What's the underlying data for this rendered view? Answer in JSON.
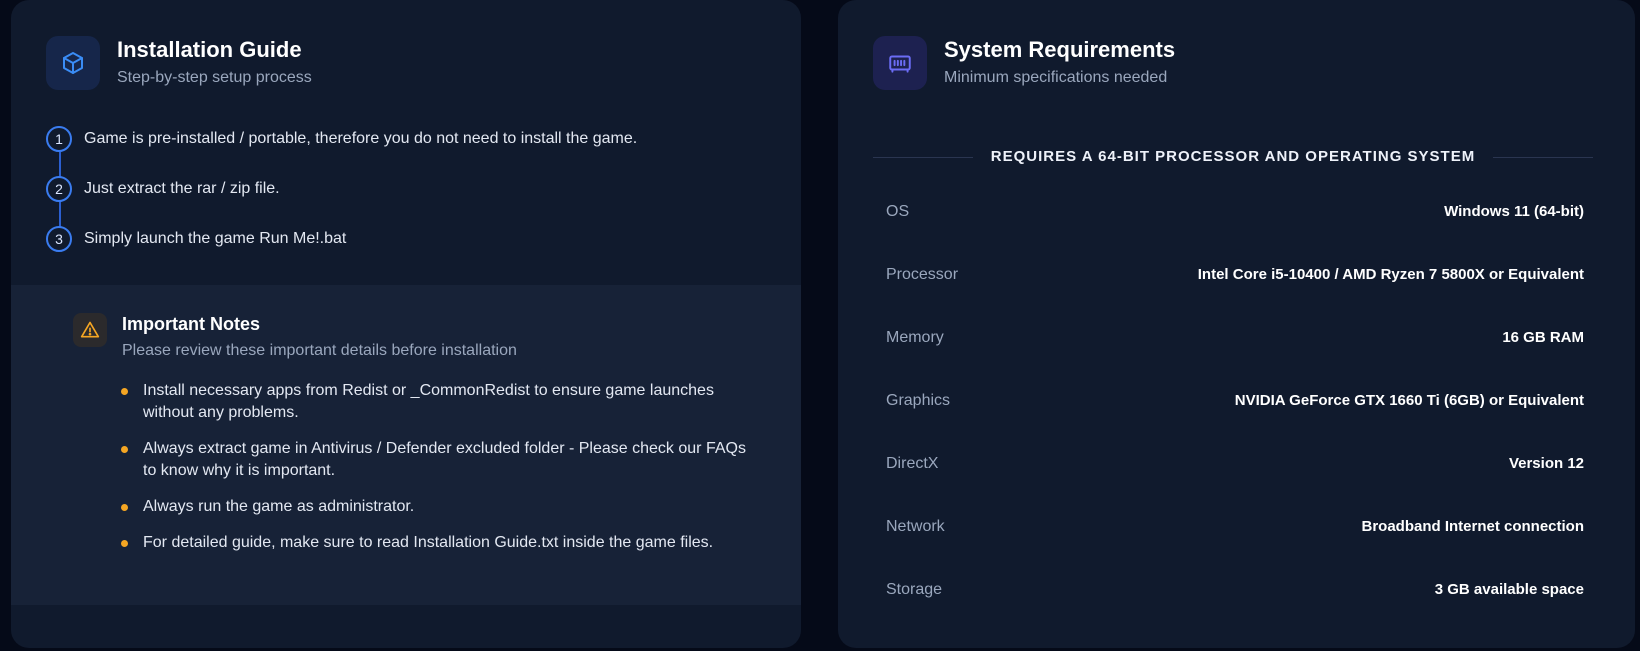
{
  "installation": {
    "title": "Installation Guide",
    "subtitle": "Step-by-step setup process",
    "steps": [
      {
        "num": "1",
        "text": "Game is pre-installed / portable, therefore you do not need to install the game."
      },
      {
        "num": "2",
        "text": "Just extract the rar / zip file."
      },
      {
        "num": "3",
        "text": "Simply launch the game Run Me!.bat"
      }
    ],
    "icon": "cube-icon",
    "accent": "#3a7cf0"
  },
  "notes": {
    "title": "Important Notes",
    "subtitle": "Please review these important details before installation",
    "icon": "warning-icon",
    "bullet_color": "#f5a623",
    "items": [
      "Install necessary apps from Redist or _CommonRedist to ensure game launches without any problems.",
      "Always extract game in Antivirus / Defender excluded folder - Please check our FAQs to know why it is important.",
      "Always run the game as administrator.",
      "For detailed guide, make sure to read Installation Guide.txt inside the game files."
    ]
  },
  "requirements": {
    "title": "System Requirements",
    "subtitle": "Minimum specifications needed",
    "icon": "chip-icon",
    "banner": "REQUIRES A 64-BIT PROCESSOR AND OPERATING SYSTEM",
    "specs": [
      {
        "label": "OS",
        "value": "Windows 11 (64-bit)"
      },
      {
        "label": "Processor",
        "value": "Intel Core i5-10400 / AMD Ryzen 7 5800X or Equivalent"
      },
      {
        "label": "Memory",
        "value": "16 GB RAM"
      },
      {
        "label": "Graphics",
        "value": "NVIDIA GeForce GTX 1660 Ti (6GB) or Equivalent"
      },
      {
        "label": "DirectX",
        "value": "Version 12"
      },
      {
        "label": "Network",
        "value": "Broadband Internet connection"
      },
      {
        "label": "Storage",
        "value": "3 GB available space"
      }
    ]
  }
}
